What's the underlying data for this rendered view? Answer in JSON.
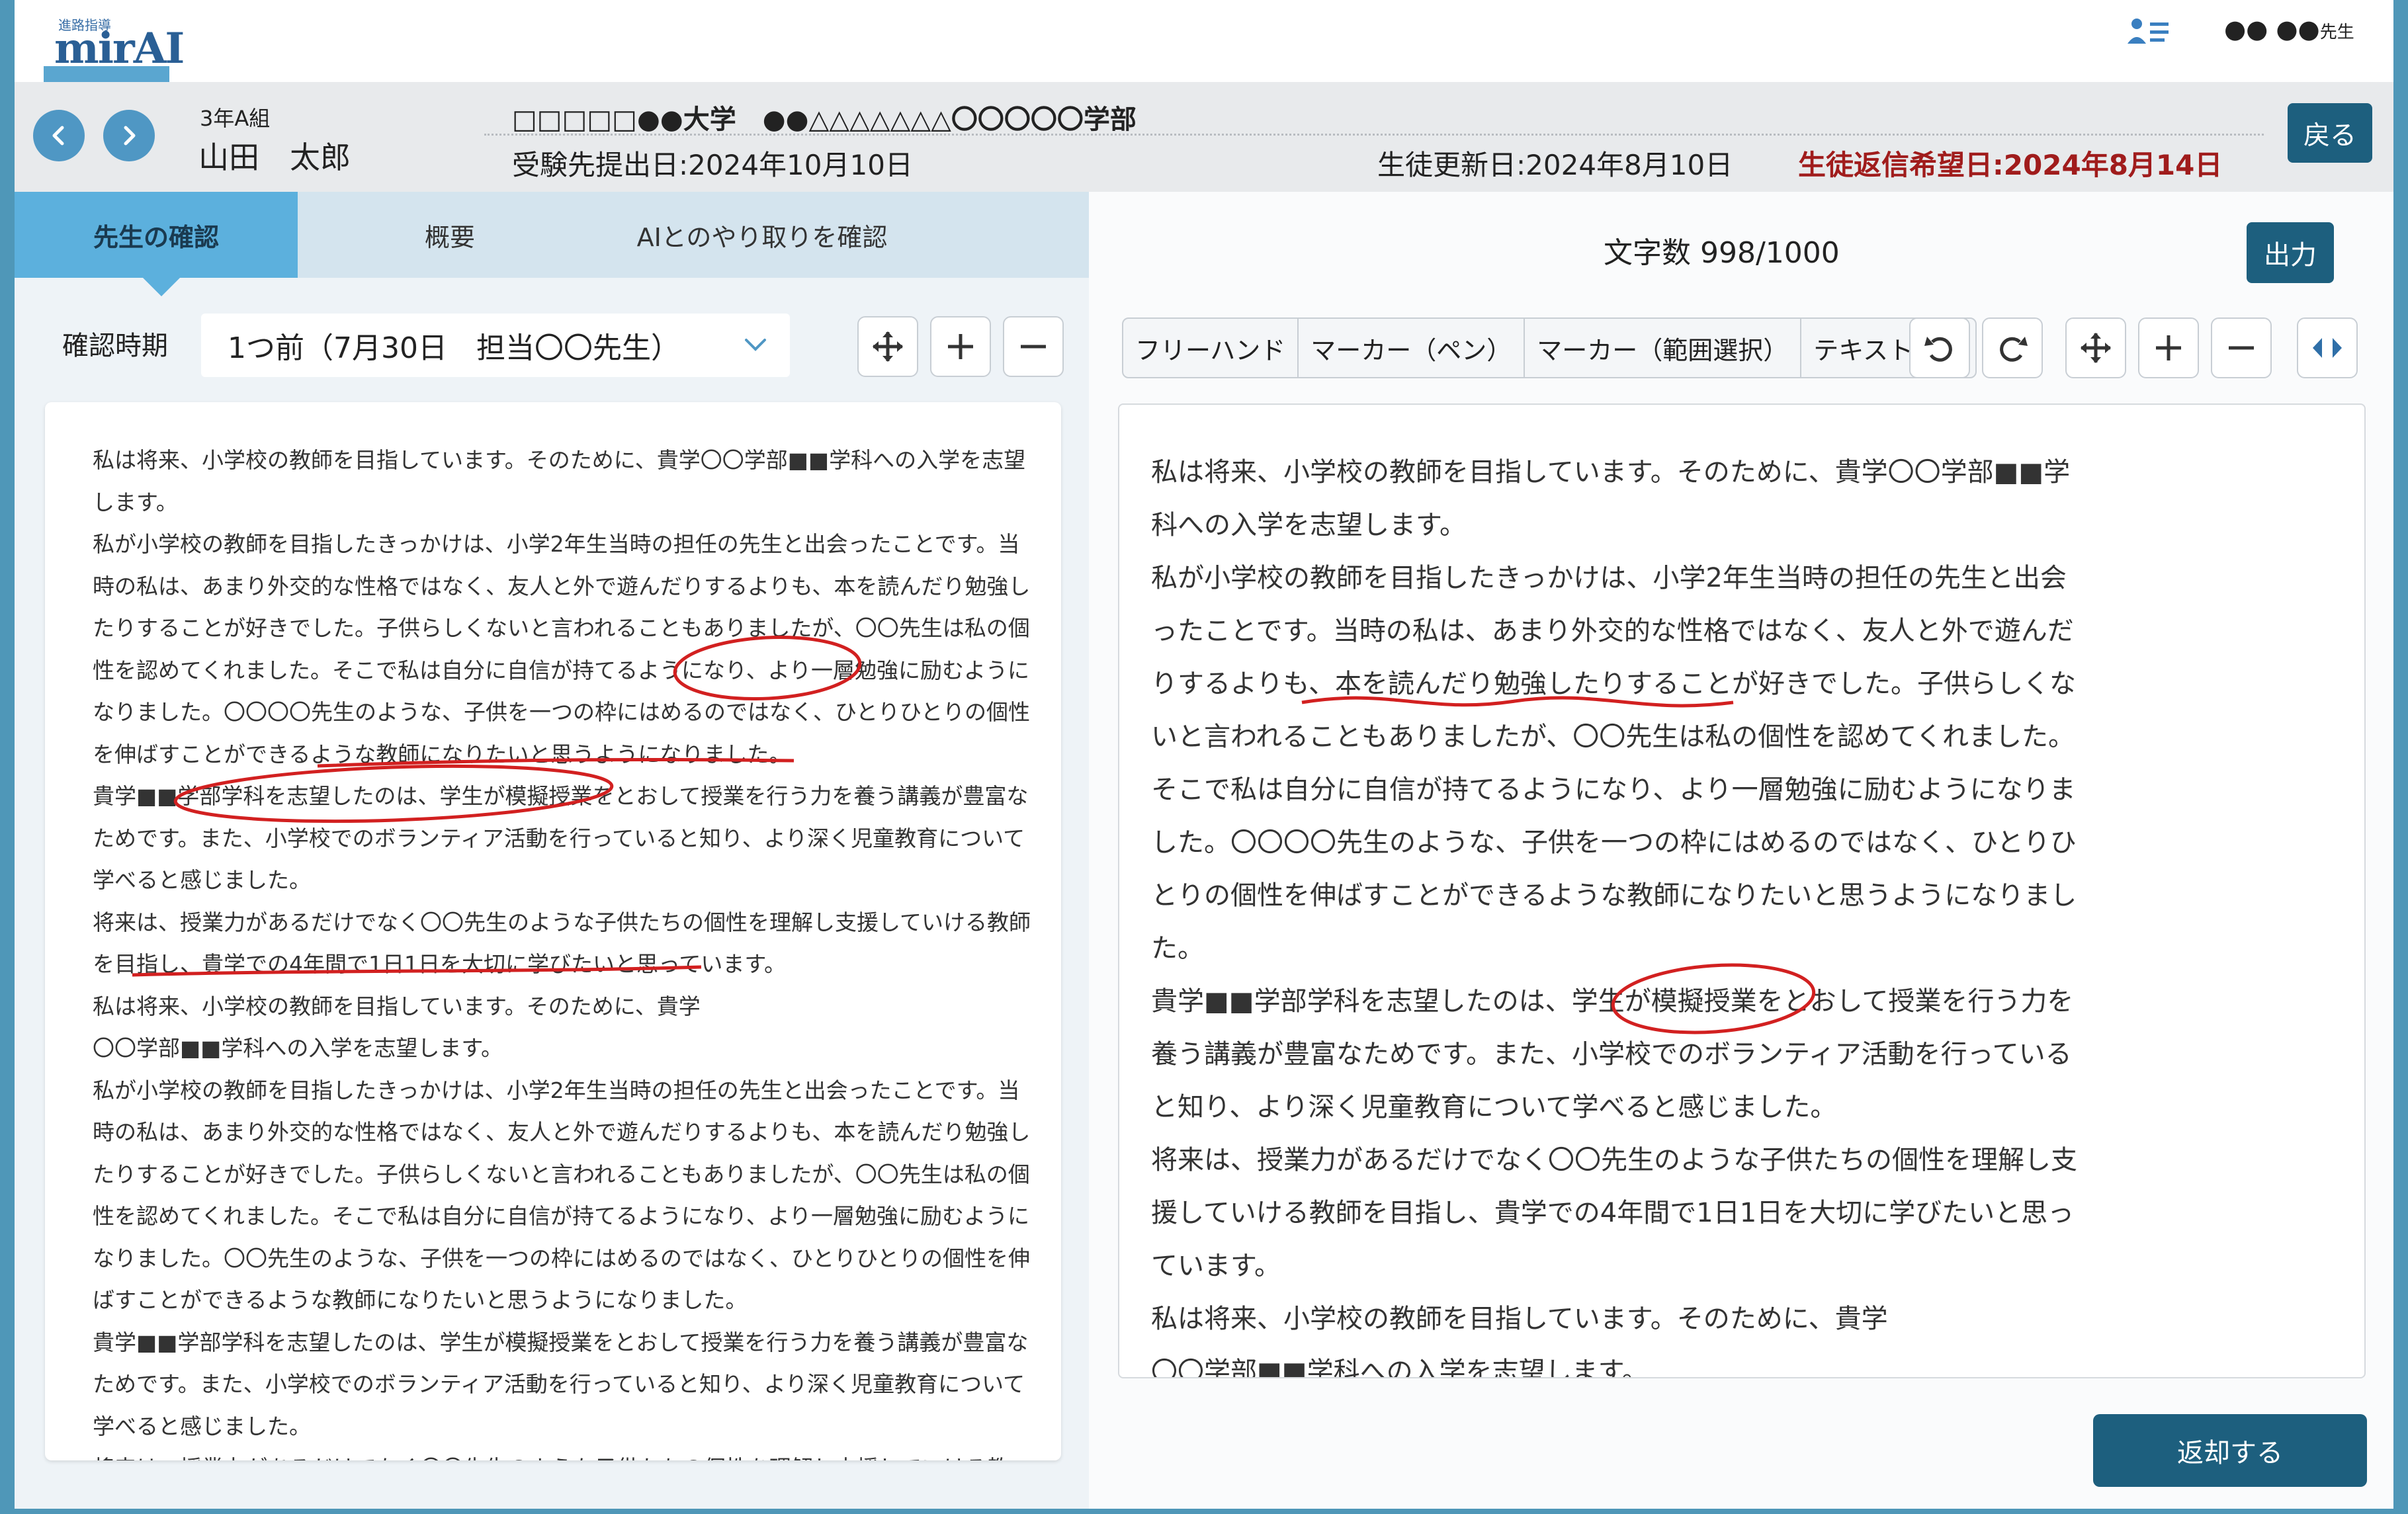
{
  "app": {
    "logo_small": "進路指導",
    "logo_text": "mirAI",
    "user_name": "●● ●●",
    "user_suffix": "先生"
  },
  "header": {
    "class": "3年A組",
    "student_name": "山田　太郎",
    "school": "□□□□□●●大学　●●△△△△△△△〇〇〇〇〇学部",
    "exam_submission_date": "受験先提出日:2024年10月10日",
    "student_update_date": "生徒更新日:2024年8月10日",
    "reply_requested_date": "生徒返信希望日:2024年8月14日",
    "back_label": "戻る"
  },
  "left_pane": {
    "tabs": [
      "先生の確認",
      "概要",
      "AIとのやり取りを確認"
    ],
    "confirm_label": "確認時期",
    "period_value": "1つ前（7月30日　担当〇〇先生）",
    "essay_paragraphs": [
      "私は将来、小学校の教師を目指しています。そのために、貴学〇〇学部■■学科への入学を志望します。",
      "私が小学校の教師を目指したきっかけは、小学2年生当時の担任の先生と出会ったことです。当時の私は、あまり外交的な性格ではなく、友人と外で遊んだりするよりも、本を読んだり勉強したりすることが好きでした。子供らしくないと言われることもありましたが、〇〇先生は私の個性を認めてくれました。そこで私は自分に自信が持てるようになり、より一層勉強に励むようになりました。〇〇〇〇先生のような、子供を一つの枠にはめるのではなく、ひとりひとりの個性を伸ばすことができるような教師になりたいと思うようになりました。",
      "貴学■■学部学科を志望したのは、学生が模擬授業をとおして授業を行う力を養う講義が豊富なためです。また、小学校でのボランティア活動を行っていると知り、より深く児童教育について学べると感じました。",
      "将来は、授業力があるだけでなく〇〇先生のような子供たちの個性を理解し支援していける教師を目指し、貴学での4年間で1日1日を大切に学びたいと思っています。",
      "私は将来、小学校の教師を目指しています。そのために、貴学\n〇〇学部■■学科への入学を志望します。",
      "私が小学校の教師を目指したきっかけは、小学2年生当時の担任の先生と出会ったことです。当時の私は、あまり外交的な性格ではなく、友人と外で遊んだりするよりも、本を読んだり勉強したりすることが好きでした。子供らしくないと言われることもありましたが、〇〇先生は私の個性を認めてくれました。そこで私は自分に自信が持てるようになり、より一層勉強に励むようになりました。〇〇先生のような、子供を一つの枠にはめるのではなく、ひとりひとりの個性を伸ばすことができるような教師になりたいと思うようになりました。",
      "貴学■■学部学科を志望したのは、学生が模擬授業をとおして授業を行う力を養う講義が豊富なためです。また、小学校でのボランティア活動を行っていると知り、より深く児童教育について学べると感じました。",
      "将来は、授業力があるだけでなく〇〇先生のような子供たちの個性を理解し支援していける教"
    ]
  },
  "right_pane": {
    "char_count": "文字数 998/1000",
    "output_label": "出力",
    "annotation_tools": [
      "フリーハンド",
      "マーカー（ペン）",
      "マーカー（範囲選択）",
      "テキスト入力"
    ],
    "essay_paragraphs": [
      "私は将来、小学校の教師を目指しています。そのために、貴学〇〇学部■■学科への入学を志望します。",
      "私が小学校の教師を目指したきっかけは、小学2年生当時の担任の先生と出会ったことです。当時の私は、あまり外交的な性格ではなく、友人と外で遊んだりするよりも、本を読んだり勉強したりすることが好きでした。子供らしくないと言われることもありましたが、〇〇先生は私の個性を認めてくれました。そこで私は自分に自信が持てるようになり、より一層勉強に励むようになりました。〇〇〇〇先生のような、子供を一つの枠にはめるのではなく、ひとりひとりの個性を伸ばすことができるような教師になりたいと思うようになりました。",
      "貴学■■学部学科を志望したのは、学生が模擬授業をとおして授業を行う力を養う講義が豊富なためです。また、小学校でのボランティア活動を行っていると知り、より深く児童教育について学べると感じました。",
      "将来は、授業力があるだけでなく〇〇先生のような子供たちの個性を理解し支援していける教師を目指し、貴学での4年間で1日1日を大切に学びたいと思っています。",
      "私は将来、小学校の教師を目指しています。そのために、貴学\n〇〇学部■■学科への入学を志望します。"
    ],
    "return_label": "返却する"
  },
  "colors": {
    "primary": "#1d5f7e",
    "accent": "#4f97c4",
    "tab_active": "#5cb0dd",
    "alert": "#a01c1c",
    "annotation": "#d22020"
  },
  "icons": [
    "user-list-icon",
    "chevron-left-icon",
    "chevron-right-icon",
    "chevron-down-icon",
    "move-icon",
    "zoom-in-icon",
    "zoom-out-icon",
    "undo-icon",
    "redo-icon",
    "expand-horizontal-icon"
  ]
}
